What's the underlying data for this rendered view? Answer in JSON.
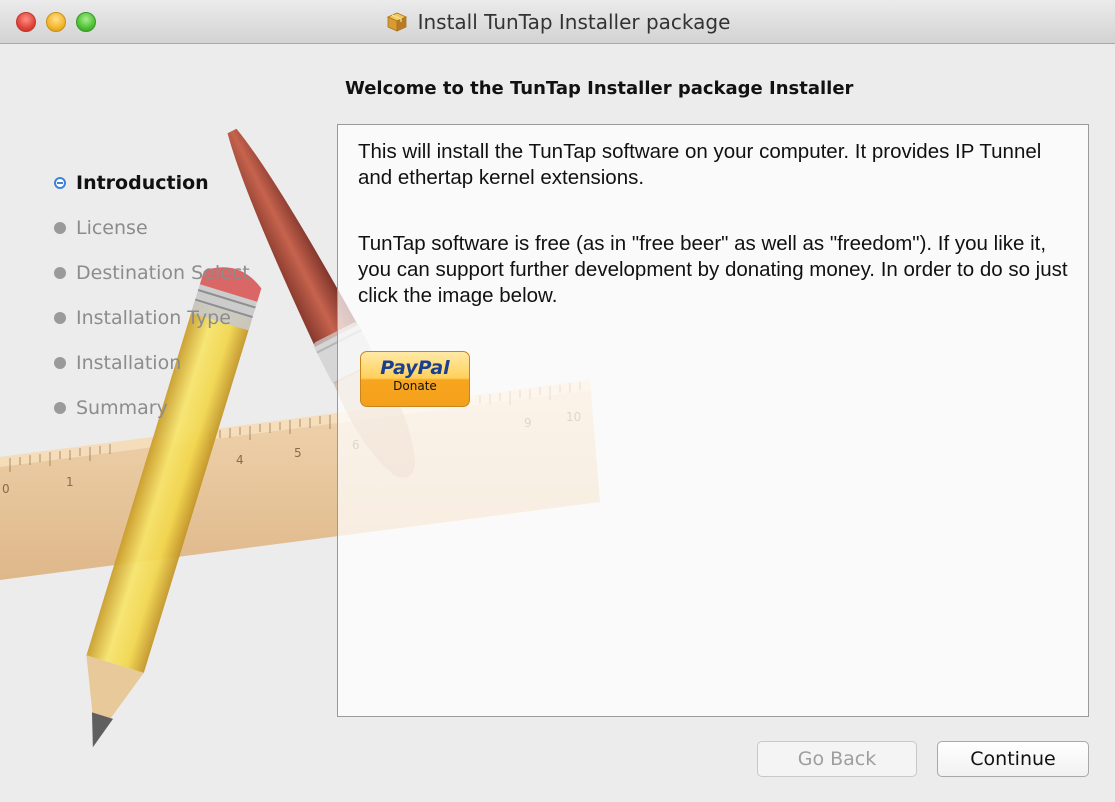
{
  "window": {
    "title": "Install TunTap Installer package"
  },
  "page": {
    "heading": "Welcome to the TunTap Installer package Installer"
  },
  "sidebar": {
    "steps": [
      {
        "label": "Introduction",
        "active": true
      },
      {
        "label": "License",
        "active": false
      },
      {
        "label": "Destination Select",
        "active": false
      },
      {
        "label": "Installation Type",
        "active": false
      },
      {
        "label": "Installation",
        "active": false
      },
      {
        "label": "Summary",
        "active": false
      }
    ]
  },
  "content": {
    "paragraph1": "This will install the TunTap software on your computer. It provides IP Tunnel and ethertap kernel extensions.",
    "paragraph2": "TunTap software is free (as in \"free beer\" as well as \"freedom\"). If you like it, you can support further development by donating money. In order to do so just click the image below.",
    "paypal": {
      "brand": "PayPal",
      "label": "Donate"
    }
  },
  "buttons": {
    "back": "Go Back",
    "continue": "Continue"
  },
  "ruler": {
    "numbers": [
      "0",
      "1",
      "4",
      "5",
      "6",
      "9",
      "10"
    ]
  },
  "colors": {
    "accent": "#3f82d9",
    "paypal_blue": "#1b3f8f",
    "paypal_orange": "#f4a01c"
  }
}
